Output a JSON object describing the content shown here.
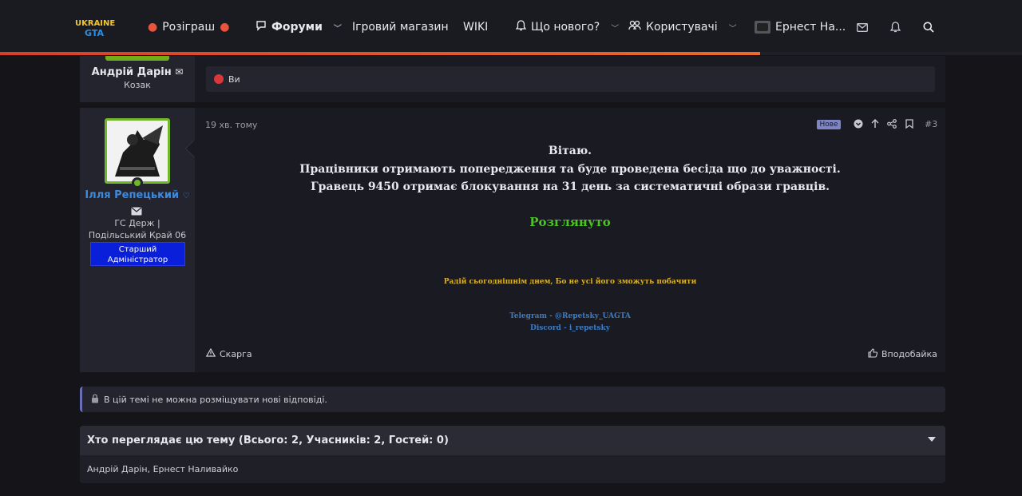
{
  "nav": {
    "logo_text_top": "UKRAINE",
    "logo_text_bottom": "GTA",
    "giveaway": "Розіграш",
    "forums": "Форуми",
    "shop": "Ігровий магазин",
    "wiki": "WIKI",
    "whats_new": "Що нового?",
    "users": "Користувачі",
    "account": "Ернест На..."
  },
  "post1": {
    "author": "Андрій Дарін",
    "role": "Козак",
    "reaction_text": "Ви"
  },
  "post2": {
    "author": "Ілля Репецький",
    "title_line1": "ГС Держ |",
    "title_line2": "Подільський Край 06",
    "badge_line1": "Старший",
    "badge_line2": "Адміністратор",
    "time": "19 хв. тому",
    "new_label": "Нове",
    "post_number": "#3",
    "greeting": "Вітаю.",
    "line1": "Працівники отримають попередження та буде проведена бесіда що до уважності.",
    "line2": "Гравець 9450 отримає блокування на 31 день за систематичні образи гравців.",
    "status": "Розглянуто",
    "signature_quote": "Радій сьогоднішнім днем, Бо не усі його зможуть побачити",
    "telegram": "Telegram - @Repetsky_UAGTA",
    "discord": "Discord - i_repetsky",
    "report": "Скарга",
    "like": "Вподобайка"
  },
  "notice": "В цій темі не можна розміщувати нові відповіді.",
  "watchers": {
    "title": "Хто переглядає цю тему (Всього: 2, Учасників: 2, Гостей: 0)",
    "list": "Андрій Дарін, Ернест Наливайко"
  }
}
